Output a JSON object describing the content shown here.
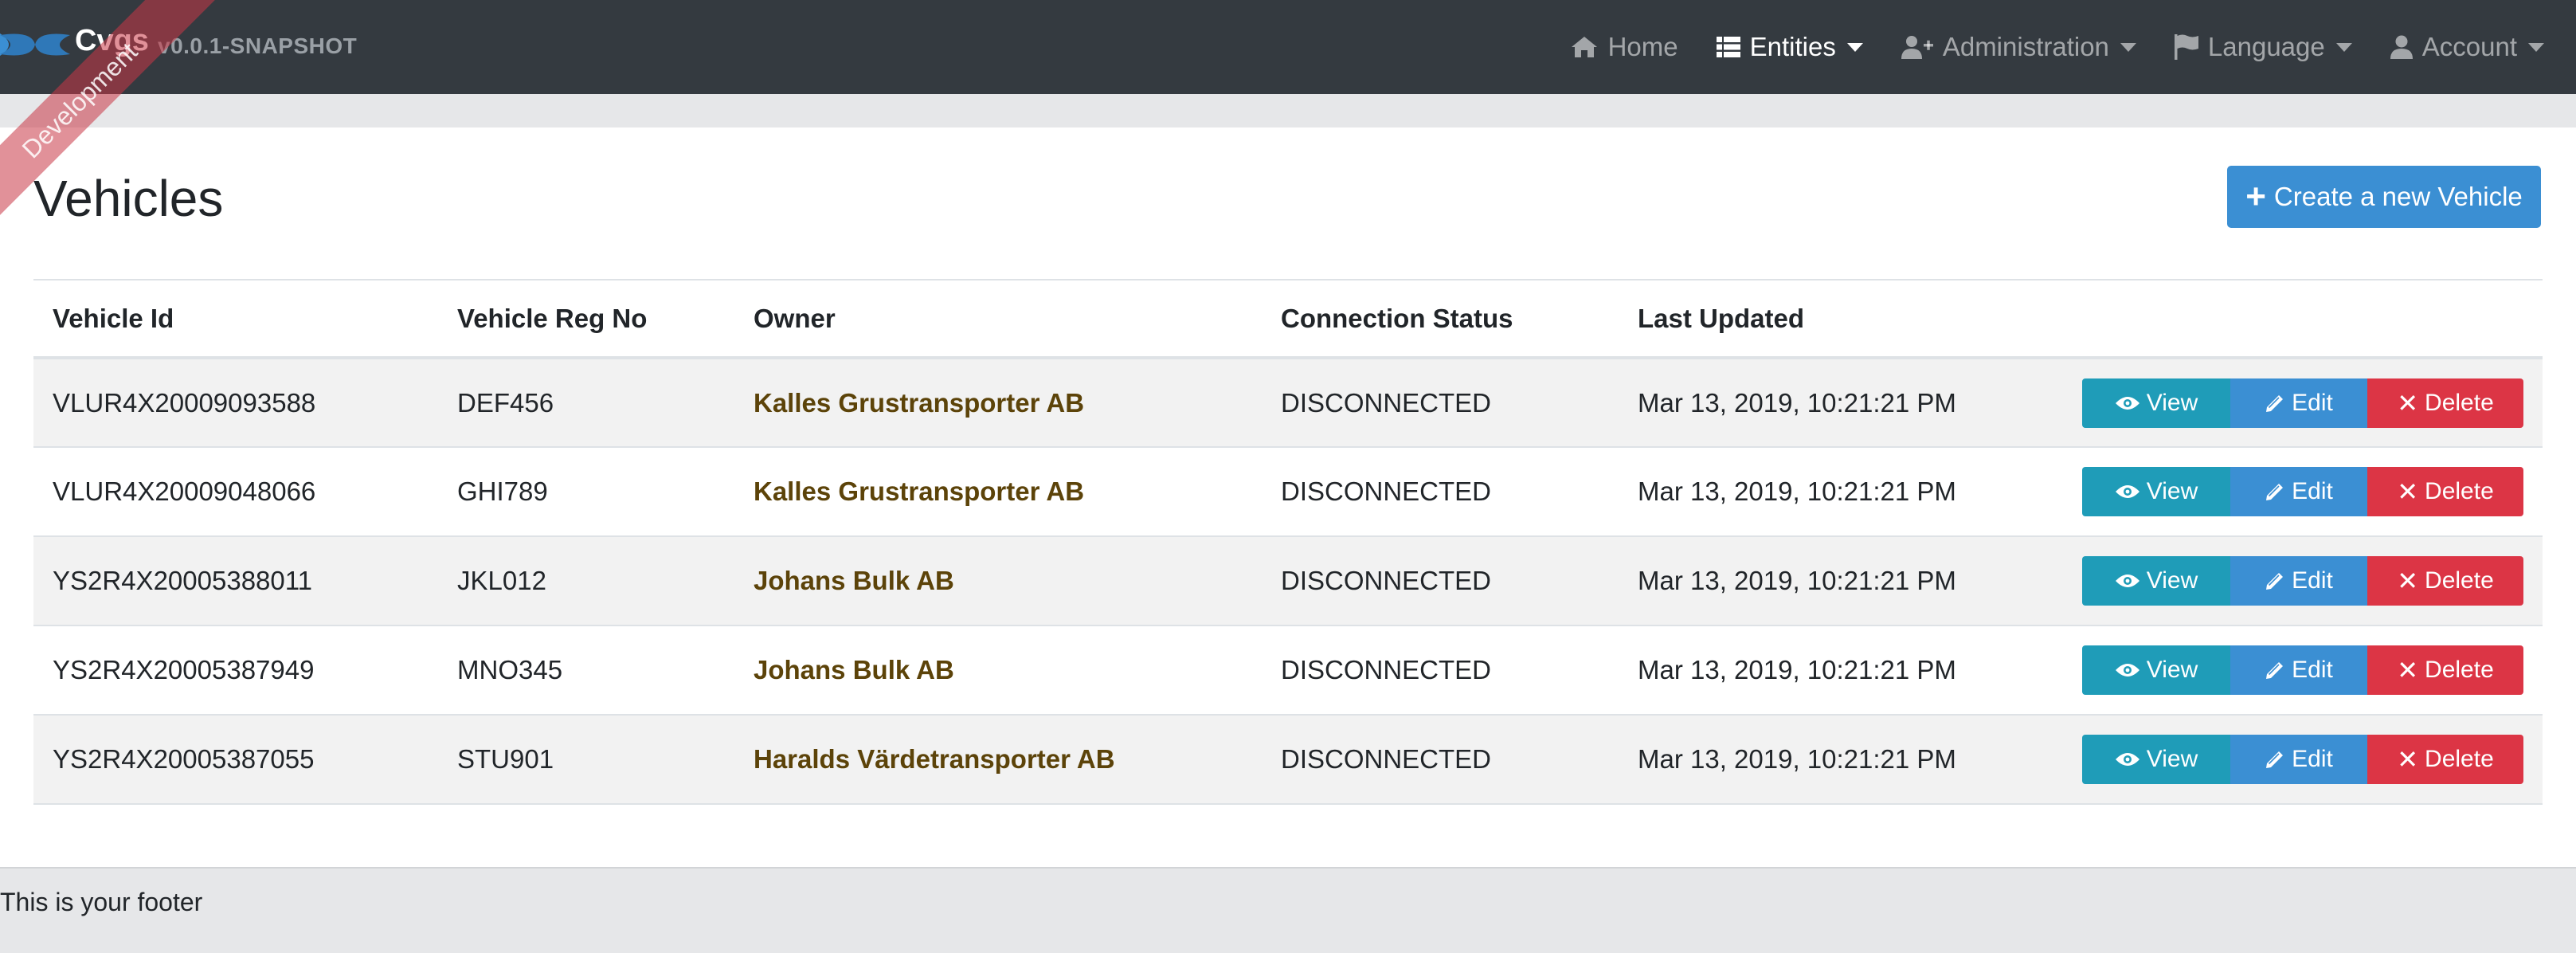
{
  "brand": {
    "title": "Cvgs",
    "version": "v0.0.1-SNAPSHOT",
    "ribbon": "Development"
  },
  "nav": {
    "home": "Home",
    "entities": "Entities",
    "administration": "Administration",
    "language": "Language",
    "account": "Account"
  },
  "page": {
    "title": "Vehicles",
    "create_button": "Create a new Vehicle"
  },
  "table": {
    "headers": {
      "vehicle_id": "Vehicle Id",
      "reg_no": "Vehicle Reg No",
      "owner": "Owner",
      "status": "Connection Status",
      "updated": "Last Updated"
    },
    "rows": [
      {
        "vehicle_id": "VLUR4X20009093588",
        "reg_no": "DEF456",
        "owner": "Kalles Grustransporter AB",
        "status": "DISCONNECTED",
        "updated": "Mar 13, 2019, 10:21:21 PM"
      },
      {
        "vehicle_id": "VLUR4X20009048066",
        "reg_no": "GHI789",
        "owner": "Kalles Grustransporter AB",
        "status": "DISCONNECTED",
        "updated": "Mar 13, 2019, 10:21:21 PM"
      },
      {
        "vehicle_id": "YS2R4X20005388011",
        "reg_no": "JKL012",
        "owner": "Johans Bulk AB",
        "status": "DISCONNECTED",
        "updated": "Mar 13, 2019, 10:21:21 PM"
      },
      {
        "vehicle_id": "YS2R4X20005387949",
        "reg_no": "MNO345",
        "owner": "Johans Bulk AB",
        "status": "DISCONNECTED",
        "updated": "Mar 13, 2019, 10:21:21 PM"
      },
      {
        "vehicle_id": "YS2R4X20005387055",
        "reg_no": "STU901",
        "owner": "Haralds Värdetransporter AB",
        "status": "DISCONNECTED",
        "updated": "Mar 13, 2019, 10:21:21 PM"
      }
    ],
    "actions": {
      "view": "View",
      "edit": "Edit",
      "delete": "Delete"
    }
  },
  "footer": {
    "text": "This is your footer"
  },
  "icons": {
    "home": "home-icon",
    "entities": "list-icon",
    "administration": "user-plus-icon",
    "language": "flag-icon",
    "account": "user-icon",
    "create": "plus-icon",
    "view": "eye-icon",
    "edit": "pencil-icon",
    "delete": "times-icon"
  },
  "colors": {
    "navbar": "#343a40",
    "primary": "#3b8fd3",
    "info": "#1f9cb8",
    "danger": "#dc3545",
    "owner_link": "#5c4309"
  }
}
